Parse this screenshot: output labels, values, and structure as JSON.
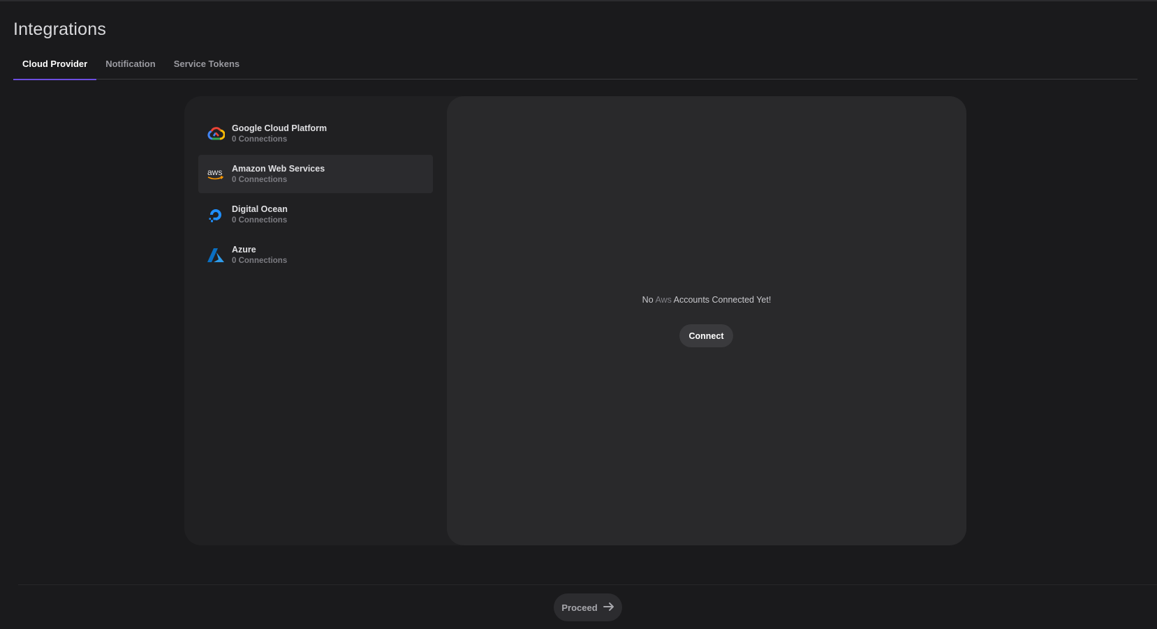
{
  "page": {
    "title": "Integrations"
  },
  "tabs": [
    {
      "label": "Cloud Provider",
      "active": true
    },
    {
      "label": "Notification",
      "active": false
    },
    {
      "label": "Service Tokens",
      "active": false
    }
  ],
  "providers": [
    {
      "name": "Google Cloud Platform",
      "connections": "0 Connections",
      "icon": "google-cloud-icon",
      "selected": false
    },
    {
      "name": "Amazon Web Services",
      "connections": "0 Connections",
      "icon": "aws-icon",
      "selected": true
    },
    {
      "name": "Digital Ocean",
      "connections": "0 Connections",
      "icon": "digital-ocean-icon",
      "selected": false
    },
    {
      "name": "Azure",
      "connections": "0 Connections",
      "icon": "azure-icon",
      "selected": false
    }
  ],
  "detail": {
    "message_prefix": "No",
    "message_provider": "Aws",
    "message_suffix": "Accounts Connected Yet!",
    "connect_label": "Connect"
  },
  "footer": {
    "proceed_label": "Proceed",
    "proceed_icon": "arrow-right-icon"
  },
  "colors": {
    "accent": "#6d4ee0",
    "background": "#1a1a1c",
    "panel": "#202022",
    "detail": "#29292b"
  }
}
